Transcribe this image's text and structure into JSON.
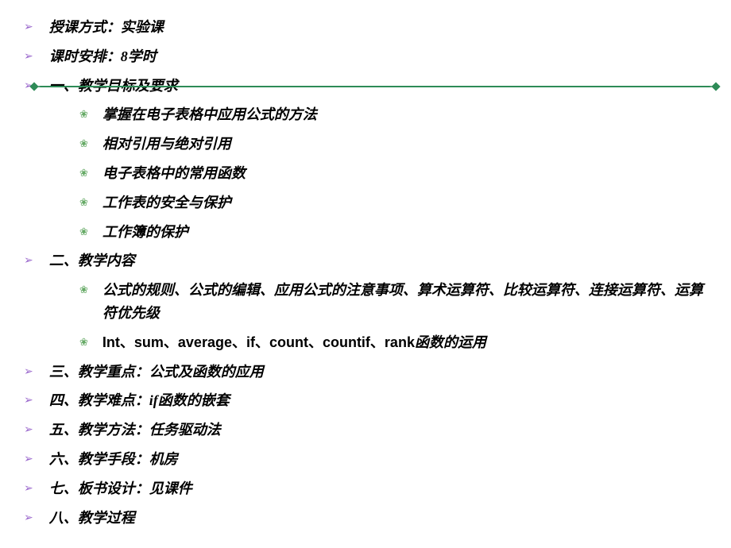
{
  "items": [
    {
      "type": "main",
      "text": "授课方式：实验课"
    },
    {
      "type": "main",
      "text": "课时安排：8学时"
    },
    {
      "type": "main",
      "text": "一、教学目标及要求"
    },
    {
      "type": "sub",
      "text": "掌握在电子表格中应用公式的方法"
    },
    {
      "type": "sub",
      "text": "相对引用与绝对引用"
    },
    {
      "type": "sub",
      "text": "电子表格中的常用函数"
    },
    {
      "type": "sub",
      "text": "工作表的安全与保护"
    },
    {
      "type": "sub",
      "text": "工作簿的保护"
    },
    {
      "type": "main",
      "text": "二、教学内容"
    },
    {
      "type": "sub",
      "text": "公式的规则、公式的编辑、应用公式的注意事项、算术运算符、比较运算符、连接运算符、运算符优先级"
    },
    {
      "type": "sub",
      "text": "Int、sum、average、if、count、countif、rank函数的运用",
      "mixed": true
    },
    {
      "type": "main",
      "text": "三、教学重点：公式及函数的应用"
    },
    {
      "type": "main",
      "text": "四、教学难点：if函数的嵌套"
    },
    {
      "type": "main",
      "text": "五、教学方法：任务驱动法"
    },
    {
      "type": "main",
      "text": "六、教学手段：机房"
    },
    {
      "type": "main",
      "text": "七、板书设计：见课件"
    },
    {
      "type": "main",
      "text": "八、教学过程"
    }
  ],
  "bullets": {
    "arrow": "➢",
    "circle": "❀"
  }
}
